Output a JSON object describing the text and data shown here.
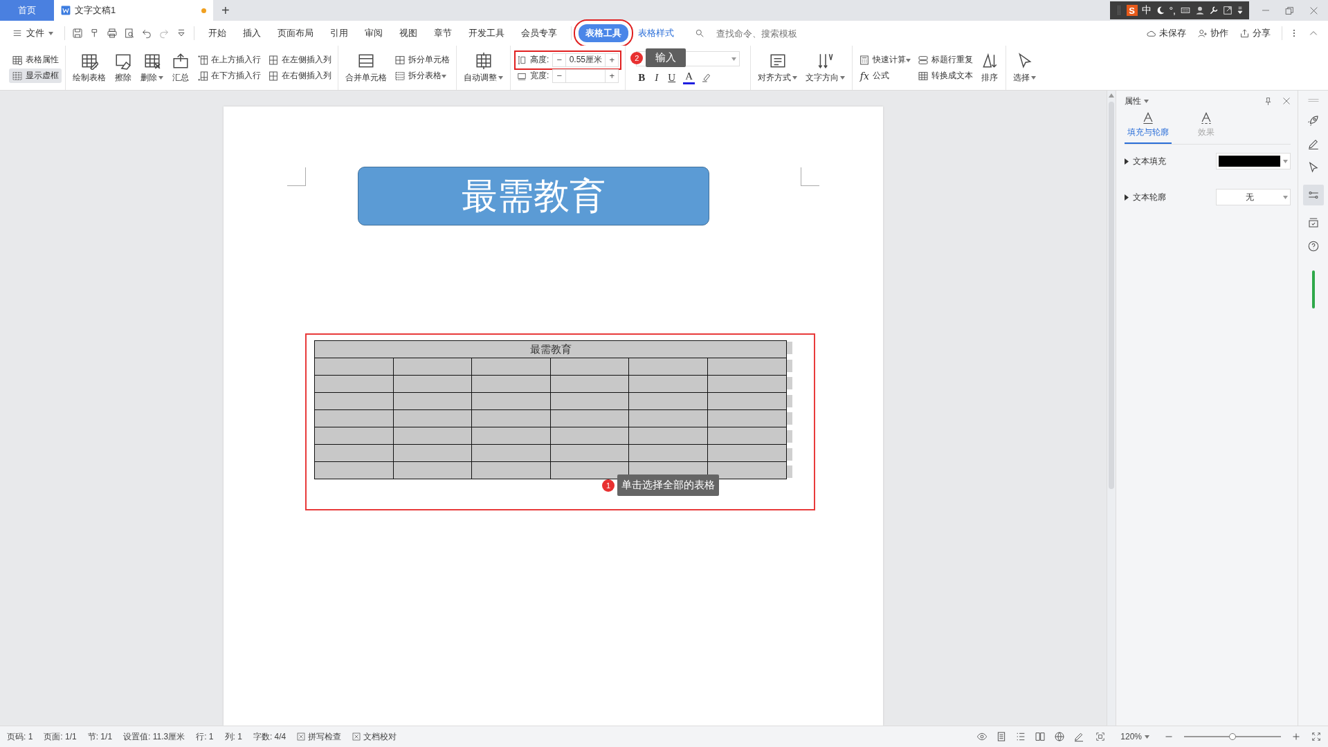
{
  "title_bar": {
    "tabs": [
      {
        "label": "首页",
        "kind": "home",
        "selected": false
      },
      {
        "label": "文字文稿1",
        "kind": "document",
        "selected": true,
        "modified": true
      }
    ],
    "new_tab": "+",
    "ime_bar": {
      "logo": "S",
      "mode": "中",
      "punctuation": "°,"
    }
  },
  "menu_bar": {
    "file": "文件",
    "items": [
      {
        "label": "开始",
        "kind": "normal",
        "selected": false
      },
      {
        "label": "插入",
        "kind": "normal",
        "selected": false
      },
      {
        "label": "页面布局",
        "kind": "normal",
        "selected": false
      },
      {
        "label": "引用",
        "kind": "normal",
        "selected": false
      },
      {
        "label": "审阅",
        "kind": "normal",
        "selected": false
      },
      {
        "label": "视图",
        "kind": "normal",
        "selected": false
      },
      {
        "label": "章节",
        "kind": "normal",
        "selected": false
      },
      {
        "label": "开发工具",
        "kind": "normal",
        "selected": false
      },
      {
        "label": "会员专享",
        "kind": "normal",
        "selected": false
      },
      {
        "label": "表格工具",
        "kind": "contextual",
        "selected": true
      },
      {
        "label": "表格样式",
        "kind": "contextual",
        "selected": false
      }
    ],
    "search": {
      "placeholder": "查找命令、搜索模板"
    },
    "actions": [
      "未保存",
      "协作",
      "分享"
    ]
  },
  "ribbon": {
    "groups": [
      {
        "parts": [
          {
            "kind": "stack",
            "items": [
              {
                "label": "表格属性",
                "on": false
              },
              {
                "label": "显示虚框",
                "on": true
              }
            ]
          }
        ]
      },
      {
        "parts": [
          {
            "kind": "large",
            "items": [
              {
                "label": "绘制表格",
                "dropdown": false
              },
              {
                "label": "擦除",
                "dropdown": false
              },
              {
                "label": "删除",
                "dropdown": true
              },
              {
                "label": "汇总",
                "dropdown": false
              }
            ]
          },
          {
            "kind": "stack",
            "items": [
              {
                "label": "在上方插入行"
              },
              {
                "label": "在下方插入行"
              }
            ]
          },
          {
            "kind": "stack",
            "items": [
              {
                "label": "在左侧插入列"
              },
              {
                "label": "在右侧插入列"
              }
            ]
          }
        ]
      },
      {
        "parts": [
          {
            "kind": "large",
            "items": [
              {
                "label": "合并单元格",
                "dropdown": false
              }
            ]
          },
          {
            "kind": "stack",
            "items": [
              {
                "label": "拆分单元格",
                "dropdown": false
              },
              {
                "label": "拆分表格",
                "dropdown": true
              }
            ]
          }
        ]
      },
      {
        "parts": [
          {
            "kind": "large",
            "items": [
              {
                "label": "自动调整",
                "dropdown": true
              }
            ]
          }
        ]
      },
      {
        "parts": [
          {
            "kind": "size",
            "items": [
              {
                "label": "高度:",
                "decrement": "−",
                "value": "0.55厘米",
                "increment": "+"
              },
              {
                "label": "宽度:",
                "decrement": "−",
                "increment": "+"
              }
            ]
          }
        ]
      },
      {
        "parts": [
          {
            "kind": "font",
            "items": [
              {
                "label": "B",
                "kind": "bold"
              },
              {
                "label": "I",
                "kind": "italic"
              },
              {
                "label": "U",
                "kind": "underline"
              },
              {
                "label": "A",
                "kind": "color",
                "color": "#1f1fe0"
              }
            ]
          }
        ]
      },
      {
        "parts": [
          {
            "kind": "large",
            "items": [
              {
                "label": "对齐方式",
                "dropdown": true
              },
              {
                "label": "文字方向",
                "dropdown": true
              }
            ]
          }
        ]
      },
      {
        "parts": [
          {
            "kind": "stack",
            "items": [
              {
                "label": "快速计算",
                "dropdown": true
              },
              {
                "label": "公式",
                "glyph": "fx",
                "dropdown": false
              }
            ]
          },
          {
            "kind": "stack",
            "items": [
              {
                "label": "标题行重复",
                "dropdown": false
              },
              {
                "label": "转换成文本",
                "dropdown": false
              }
            ]
          },
          {
            "kind": "large",
            "items": [
              {
                "label": "排序",
                "dropdown": false
              }
            ]
          }
        ]
      },
      {
        "parts": [
          {
            "kind": "large",
            "items": [
              {
                "label": "选择",
                "dropdown": true
              }
            ]
          }
        ]
      }
    ]
  },
  "document": {
    "heading": "最需教育",
    "table": {
      "title": "最需教育",
      "rows": [
        {
          "cells": [
            {
              "selected": true
            },
            {
              "selected": true
            },
            {
              "selected": true
            },
            {
              "selected": true
            },
            {
              "selected": true
            },
            {
              "selected": true
            }
          ]
        },
        {
          "cells": [
            {
              "selected": true
            },
            {
              "selected": true
            },
            {
              "selected": true
            },
            {
              "selected": true
            },
            {
              "selected": true
            },
            {
              "selected": true
            }
          ]
        },
        {
          "cells": [
            {
              "selected": true
            },
            {
              "selected": true
            },
            {
              "selected": true
            },
            {
              "selected": true
            },
            {
              "selected": true
            },
            {
              "selected": true
            }
          ]
        },
        {
          "cells": [
            {
              "selected": true
            },
            {
              "selected": true
            },
            {
              "selected": true
            },
            {
              "selected": true
            },
            {
              "selected": true
            },
            {
              "selected": true
            }
          ]
        },
        {
          "cells": [
            {
              "selected": true
            },
            {
              "selected": true
            },
            {
              "selected": true
            },
            {
              "selected": true
            },
            {
              "selected": true
            },
            {
              "selected": true
            }
          ]
        },
        {
          "cells": [
            {
              "selected": true
            },
            {
              "selected": true
            },
            {
              "selected": true
            },
            {
              "selected": true
            },
            {
              "selected": true
            },
            {
              "selected": true
            }
          ]
        },
        {
          "cells": [
            {
              "selected": true
            },
            {
              "selected": true
            },
            {
              "selected": true
            },
            {
              "selected": true
            },
            {
              "selected": true
            },
            {
              "selected": true
            }
          ]
        }
      ]
    }
  },
  "callouts": [
    {
      "number": "2",
      "text": "输入"
    },
    {
      "number": "1",
      "text": "单击选择全部的表格"
    }
  ],
  "properties_panel": {
    "title": "属性",
    "tabs": [
      {
        "label": "填充与轮廓",
        "selected": true
      },
      {
        "label": "效果",
        "selected": false
      }
    ],
    "rows": [
      {
        "label": "文本填充",
        "kind": "color",
        "color": "#000000"
      },
      {
        "label": "文本轮廓",
        "kind": "select",
        "value": "无"
      }
    ]
  },
  "status_bar": {
    "items": [
      "页码: 1",
      "页面: 1/1",
      "节: 1/1",
      "设置值: 11.3厘米",
      "行: 1",
      "列: 1",
      "字数: 4/4"
    ],
    "checks": [
      "拼写检查",
      "文档校对"
    ],
    "zoom": "120%",
    "zoom_slider": {
      "level": 0.5
    }
  }
}
